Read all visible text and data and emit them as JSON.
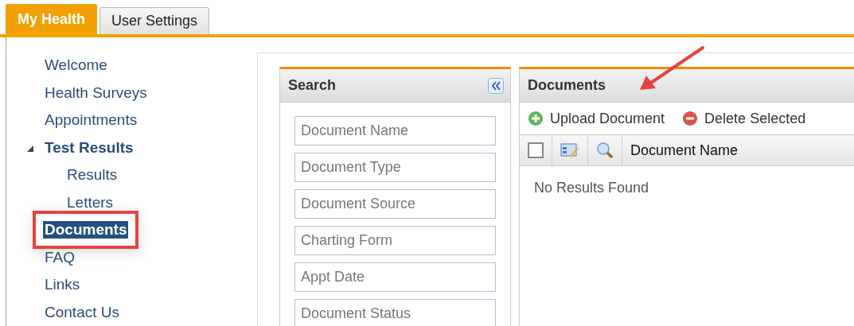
{
  "tabs": [
    {
      "label": "My Health",
      "selected": true
    },
    {
      "label": "User Settings",
      "selected": false
    }
  ],
  "nav": [
    {
      "label": "Welcome",
      "selected": false,
      "highlighted": false
    },
    {
      "label": "Health Surveys",
      "selected": false,
      "highlighted": false
    },
    {
      "label": "Appointments",
      "selected": false,
      "highlighted": false
    },
    {
      "label": "Test Results",
      "selected": false,
      "highlighted": false,
      "expanded": true,
      "children": [
        {
          "label": "Results",
          "selected": false,
          "highlighted": false
        },
        {
          "label": "Letters",
          "selected": false,
          "highlighted": false
        }
      ]
    },
    {
      "label": "Documents",
      "selected": true,
      "highlighted": true
    },
    {
      "label": "FAQ",
      "selected": false,
      "highlighted": false
    },
    {
      "label": "Links",
      "selected": false,
      "highlighted": false
    },
    {
      "label": "Contact Us",
      "selected": false,
      "highlighted": false
    }
  ],
  "search_panel": {
    "title": "Search",
    "fields": [
      {
        "placeholder": "Document Name"
      },
      {
        "placeholder": "Document Type"
      },
      {
        "placeholder": "Document Source"
      },
      {
        "placeholder": "Charting Form"
      },
      {
        "placeholder": "Appt Date"
      },
      {
        "placeholder": "Document Status"
      }
    ]
  },
  "documents_panel": {
    "title": "Documents",
    "toolbar": [
      {
        "kind": "add",
        "label": "Upload Document"
      },
      {
        "kind": "delete",
        "label": "Delete Selected"
      }
    ],
    "table": {
      "select_all_checked": false,
      "columns": [
        "Document Name"
      ],
      "empty_message": "No Results Found"
    }
  }
}
